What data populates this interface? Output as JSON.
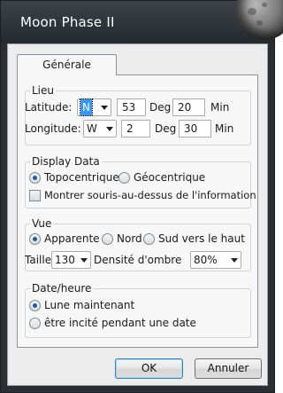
{
  "window": {
    "title": "Moon Phase II"
  },
  "tabs": [
    {
      "label": "Générale"
    }
  ],
  "lieu": {
    "legend": "Lieu",
    "latitude": {
      "label": "Latitude:",
      "hemisphere": "N",
      "degrees": "53",
      "deg_label": "Deg",
      "minutes": "20",
      "min_label": "Min"
    },
    "longitude": {
      "label": "Longitude:",
      "hemisphere": "W",
      "degrees": "2",
      "deg_label": "Deg",
      "minutes": "30",
      "min_label": "Min"
    }
  },
  "display_data": {
    "legend": "Display Data",
    "radio_topo": "Topocentrique",
    "radio_geo": "Géocentrique",
    "selected": "Topocentrique",
    "checkbox_label": "Montrer souris-au-dessus de l'information",
    "checkbox_checked": false
  },
  "vue": {
    "legend": "Vue",
    "radio_apparente": "Apparente",
    "radio_nord": "Nord",
    "radio_sud": "Sud vers le haut",
    "selected": "Apparente",
    "taille_label": "Taille",
    "taille_value": "130",
    "densite_label": "Densité d'ombre",
    "densite_value": "80%"
  },
  "date_heure": {
    "legend": "Date/heure",
    "radio_lune": "Lune maintenant",
    "radio_incite": "être incité pendant une date",
    "selected": "Lune maintenant"
  },
  "buttons": {
    "ok": "OK",
    "cancel": "Annuler"
  },
  "colors": {
    "title_bar": "#2b2f33",
    "selection": "#3399ff",
    "client": "#ececec"
  }
}
